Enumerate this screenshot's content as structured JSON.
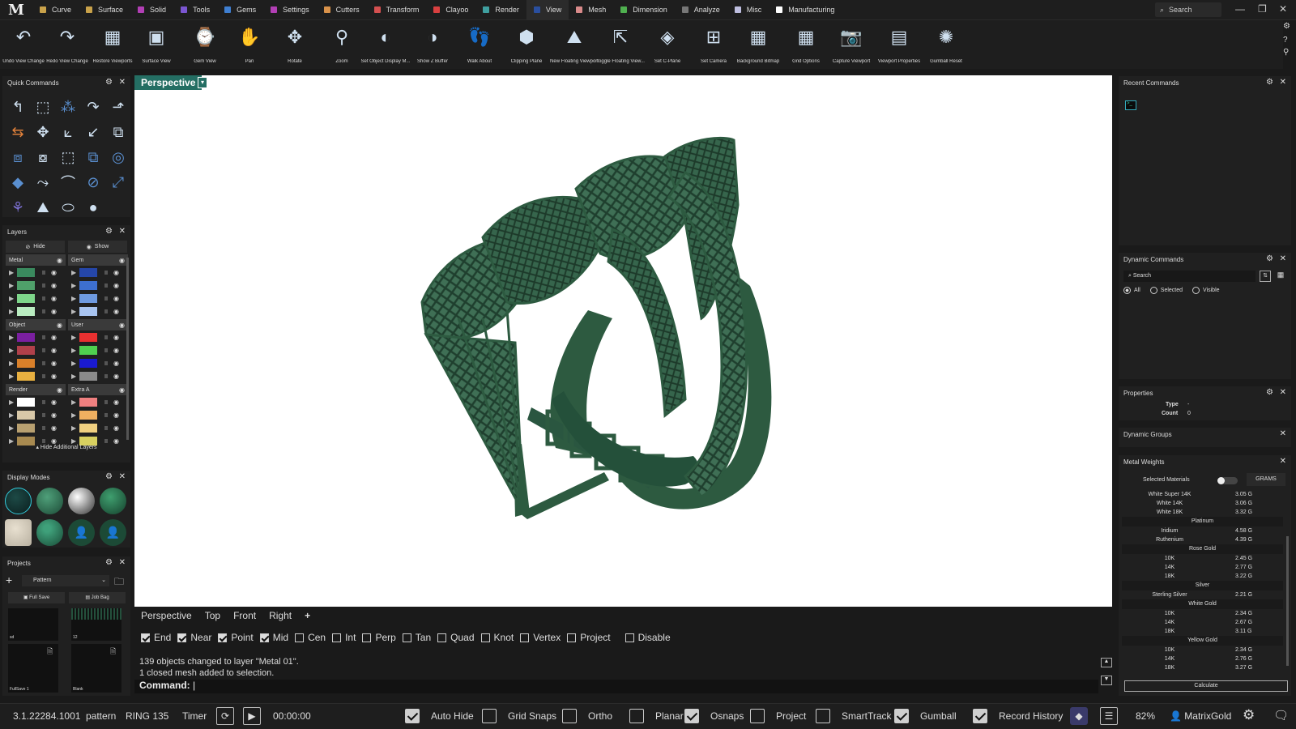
{
  "menubar": {
    "logo": "M",
    "items": [
      {
        "label": "Curve",
        "color": "#c9a24a"
      },
      {
        "label": "Surface",
        "color": "#c9a24a"
      },
      {
        "label": "Solid",
        "color": "#b23fb5"
      },
      {
        "label": "Tools",
        "color": "#7b56d1"
      },
      {
        "label": "Gems",
        "color": "#3f7fd1"
      },
      {
        "label": "Settings",
        "color": "#b23fb5"
      },
      {
        "label": "Cutters",
        "color": "#d9924a"
      },
      {
        "label": "Transform",
        "color": "#d45050"
      },
      {
        "label": "Clayoo",
        "color": "#d94040"
      },
      {
        "label": "Render",
        "color": "#3f9f9f"
      },
      {
        "label": "View",
        "color": "#2a4f9f"
      },
      {
        "label": "Mesh",
        "color": "#d98a8a"
      },
      {
        "label": "Dimension",
        "color": "#4fb04f"
      },
      {
        "label": "Analyze",
        "color": "#777777"
      },
      {
        "label": "Misc",
        "color": "#bfbfe0"
      },
      {
        "label": "Manufacturing",
        "color": "#ffffff"
      }
    ],
    "search_placeholder": "Search"
  },
  "ribbon": {
    "tools": [
      {
        "label": "Undo View Change",
        "icon": "undo-view-icon"
      },
      {
        "label": "Redo View Change",
        "icon": "redo-view-icon"
      },
      {
        "label": "Restore Viewports",
        "icon": "restore-viewports-icon"
      },
      {
        "label": "Surface View",
        "icon": "surface-view-icon"
      },
      {
        "label": "Gem View",
        "icon": "gem-view-icon"
      },
      {
        "label": "Pan",
        "icon": "pan-hand-icon"
      },
      {
        "label": "Rotate",
        "icon": "rotate-icon"
      },
      {
        "label": "Zoom",
        "icon": "zoom-icon"
      },
      {
        "label": "Set Object Display M...",
        "icon": "object-display-icon"
      },
      {
        "label": "Show Z Buffer",
        "icon": "z-buffer-icon"
      },
      {
        "label": "Walk About",
        "icon": "walk-about-icon"
      },
      {
        "label": "Clipping Plane",
        "icon": "clipping-plane-icon"
      },
      {
        "label": "New Floating Viewport",
        "icon": "floating-viewport-icon"
      },
      {
        "label": "Toggle Floating View...",
        "icon": "toggle-floating-icon"
      },
      {
        "label": "Set C-Plane",
        "icon": "cplane-icon"
      },
      {
        "label": "Set Camera",
        "icon": "camera-grid-icon"
      },
      {
        "label": "Background Bitmap",
        "icon": "background-bitmap-icon"
      },
      {
        "label": "Grid Options",
        "icon": "grid-options-icon"
      },
      {
        "label": "Capture Viewport",
        "icon": "capture-viewport-icon"
      },
      {
        "label": "Viewport Properties",
        "icon": "viewport-properties-icon"
      },
      {
        "label": "Gumball Reset",
        "icon": "gumball-reset-icon"
      }
    ]
  },
  "quick_commands": {
    "title": "Quick Commands"
  },
  "layers": {
    "title": "Layers",
    "hide_label": "Hide",
    "show_label": "Show",
    "groups": [
      {
        "name": "Metal",
        "colors": [
          "#3a8a5e",
          "#4fa06a",
          "#7ed68a",
          "#b9ecc0"
        ]
      },
      {
        "name": "Gem",
        "colors": [
          "#2546a8",
          "#3d6fd0",
          "#6e9ae0",
          "#a8c4f0"
        ]
      },
      {
        "name": "Object",
        "colors": [
          "#7a1fa0",
          "#b0404a",
          "#d9802a",
          "#e8b040"
        ]
      },
      {
        "name": "User",
        "colors": [
          "#e83030",
          "#4fd04f",
          "#1a1ad0",
          "#8a8a8a"
        ]
      },
      {
        "name": "Render",
        "colors": [
          "#ffffff",
          "#d8c8a8",
          "#b8a070",
          "#a88a50"
        ]
      },
      {
        "name": "Extra A",
        "colors": [
          "#f08080",
          "#f0b060",
          "#f0d080",
          "#d8d060"
        ]
      }
    ],
    "hide_additional": "Hide Additional Layers"
  },
  "display_modes": {
    "title": "Display Modes"
  },
  "projects": {
    "title": "Projects",
    "dropdown_value": "Pattern",
    "full_save": "Full Save",
    "job_bag": "Job Bag",
    "thumbs": [
      "sd",
      "12",
      "FullSave 1",
      "Blank"
    ]
  },
  "viewport": {
    "active_tab": "Perspective",
    "tabs": [
      "Perspective",
      "Top",
      "Front",
      "Right"
    ],
    "add_tab": "+"
  },
  "osnaps": [
    {
      "label": "End",
      "on": true
    },
    {
      "label": "Near",
      "on": true
    },
    {
      "label": "Point",
      "on": true
    },
    {
      "label": "Mid",
      "on": true
    },
    {
      "label": "Cen",
      "on": false
    },
    {
      "label": "Int",
      "on": false
    },
    {
      "label": "Perp",
      "on": false
    },
    {
      "label": "Tan",
      "on": false
    },
    {
      "label": "Quad",
      "on": false
    },
    {
      "label": "Knot",
      "on": false
    },
    {
      "label": "Vertex",
      "on": false
    },
    {
      "label": "Project",
      "on": false
    },
    {
      "label": "Disable",
      "on": false
    }
  ],
  "command": {
    "history": [
      "139 objects changed to layer \"Metal 01\".",
      "1 closed mesh added to selection."
    ],
    "prompt": "Command:"
  },
  "statusbar": {
    "version": "3.1.22284.1001",
    "project": "pattern",
    "file": "RING 135",
    "timer_label": "Timer",
    "timer_value": "00:00:00",
    "toggles": [
      {
        "label": "Auto Hide",
        "on": true
      },
      {
        "label": "Grid Snaps",
        "on": false
      },
      {
        "label": "Ortho",
        "on": false
      },
      {
        "label": "Planar",
        "on": false
      },
      {
        "label": "Osnaps",
        "on": true
      },
      {
        "label": "Project",
        "on": false
      },
      {
        "label": "SmartTrack",
        "on": false
      },
      {
        "label": "Gumball",
        "on": true
      },
      {
        "label": "Record History",
        "on": true
      }
    ],
    "zoom": "82%",
    "user": "MatrixGold"
  },
  "right_panels": {
    "recent_commands": "Recent Commands",
    "dynamic_commands": "Dynamic Commands",
    "dc_search": "Search",
    "dc_filters": [
      {
        "label": "All",
        "on": true
      },
      {
        "label": "Selected",
        "on": false
      },
      {
        "label": "Visible",
        "on": false
      }
    ],
    "properties": "Properties",
    "prop_type_label": "Type",
    "prop_type_value": "-",
    "prop_count_label": "Count",
    "prop_count_value": "0",
    "dynamic_groups": "Dynamic Groups",
    "metal_weights": "Metal Weights",
    "selected_materials": "Selected Materials",
    "units": "GRAMS",
    "calculate": "Calculate",
    "weights": [
      {
        "type": "row",
        "name": "White Super 14K",
        "value": "3.05 G"
      },
      {
        "type": "row",
        "name": "White 14K",
        "value": "3.06 G"
      },
      {
        "type": "row",
        "name": "White 18K",
        "value": "3.32 G"
      },
      {
        "type": "head",
        "name": "Platinum"
      },
      {
        "type": "row",
        "name": "Iridium",
        "value": "4.58 G"
      },
      {
        "type": "row",
        "name": "Ruthenium",
        "value": "4.39 G"
      },
      {
        "type": "head",
        "name": "Rose Gold"
      },
      {
        "type": "row",
        "name": "10K",
        "value": "2.45 G"
      },
      {
        "type": "row",
        "name": "14K",
        "value": "2.77 G"
      },
      {
        "type": "row",
        "name": "18K",
        "value": "3.22 G"
      },
      {
        "type": "head",
        "name": "Silver"
      },
      {
        "type": "row",
        "name": "Sterling Silver",
        "value": "2.21 G"
      },
      {
        "type": "head",
        "name": "White Gold"
      },
      {
        "type": "row",
        "name": "10K",
        "value": "2.34 G"
      },
      {
        "type": "row",
        "name": "14K",
        "value": "2.67 G"
      },
      {
        "type": "row",
        "name": "18K",
        "value": "3.11 G"
      },
      {
        "type": "head",
        "name": "Yellow Gold"
      },
      {
        "type": "row",
        "name": "10K",
        "value": "2.34 G"
      },
      {
        "type": "row",
        "name": "14K",
        "value": "2.76 G"
      },
      {
        "type": "row",
        "name": "18K",
        "value": "3.27 G"
      }
    ]
  },
  "colors": {
    "accent": "#246e63",
    "ring": "#2d5a40"
  }
}
